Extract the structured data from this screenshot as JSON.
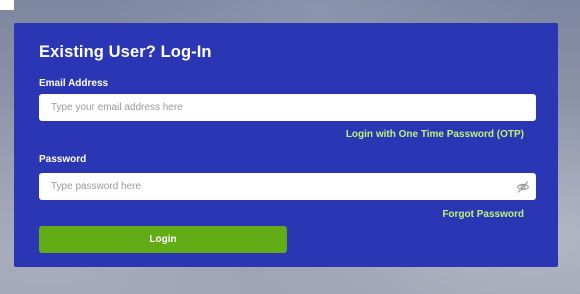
{
  "login_form": {
    "title": "Existing User? Log-In",
    "email": {
      "label": "Email Address",
      "value": "",
      "placeholder": "Type your email address here"
    },
    "otp_link": "Login with One Time Password (OTP)",
    "password": {
      "label": "Password",
      "value": "",
      "placeholder": "Type password here",
      "toggle_icon": "eye-off-icon"
    },
    "forgot_link": "Forgot Password",
    "login_button": "Login"
  },
  "colors": {
    "card_background": "#2a36b4",
    "link_color": "#c4f07a",
    "button_color": "#62ad15",
    "text_color": "#ffffff"
  }
}
